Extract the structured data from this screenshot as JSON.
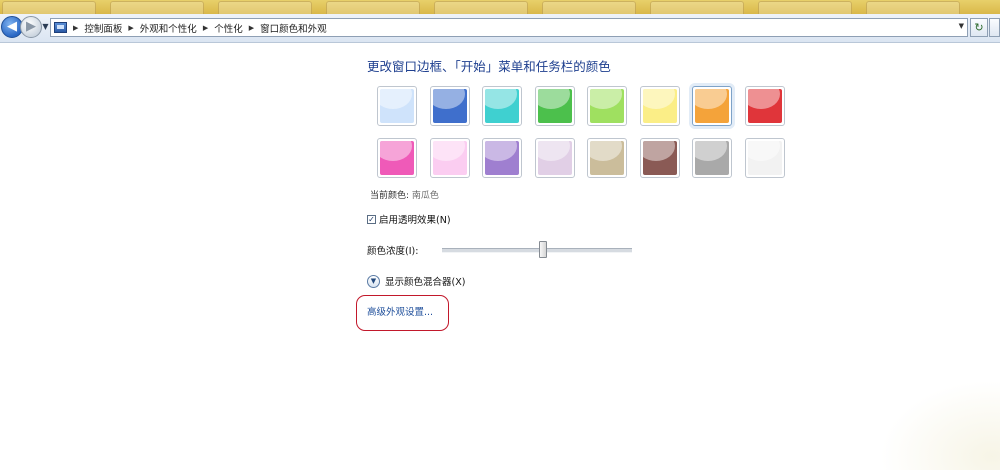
{
  "address_bar": {
    "breadcrumbs": [
      "控制面板",
      "外观和个性化",
      "个性化",
      "窗口颜色和外观"
    ]
  },
  "content": {
    "title": "更改窗口边框、「开始」菜单和任务栏的颜色",
    "color_swatches": [
      {
        "name": "sky",
        "color": "#cfe3fb",
        "selected": false
      },
      {
        "name": "twilight",
        "color": "#3f6fcc",
        "selected": false
      },
      {
        "name": "sea",
        "color": "#3fd0d0",
        "selected": false
      },
      {
        "name": "leaf",
        "color": "#4cc04c",
        "selected": false
      },
      {
        "name": "lime",
        "color": "#9fe060",
        "selected": false
      },
      {
        "name": "lemon",
        "color": "#fbee87",
        "selected": false
      },
      {
        "name": "pumpkin",
        "color": "#f4a33a",
        "selected": true
      },
      {
        "name": "ruby",
        "color": "#e0353a",
        "selected": false
      },
      {
        "name": "fuchsia",
        "color": "#ef5ab8",
        "selected": false
      },
      {
        "name": "blush",
        "color": "#fbcdf1",
        "selected": false
      },
      {
        "name": "violet",
        "color": "#9f7fd0",
        "selected": false
      },
      {
        "name": "lavender",
        "color": "#e1cfe6",
        "selected": false
      },
      {
        "name": "taupe",
        "color": "#cbbd9b",
        "selected": false
      },
      {
        "name": "chocolate",
        "color": "#8a5a55",
        "selected": false
      },
      {
        "name": "slate",
        "color": "#a9a9a9",
        "selected": false
      },
      {
        "name": "frost",
        "color": "#f2f2f2",
        "selected": false
      }
    ],
    "current_color_label": "当前颜色:",
    "current_color_value": "南瓜色",
    "transparency_label": "启用透明效果(N)",
    "transparency_checked": true,
    "intensity_label": "颜色浓度(I):",
    "intensity_level": 0.53,
    "mixer_label": "显示颜色混合器(X)",
    "advanced_link": "高级外观设置..."
  },
  "colors": {
    "title_blue": "#1e3f8f",
    "link_blue": "#1f4f9b",
    "highlight_red": "#c2182b"
  }
}
